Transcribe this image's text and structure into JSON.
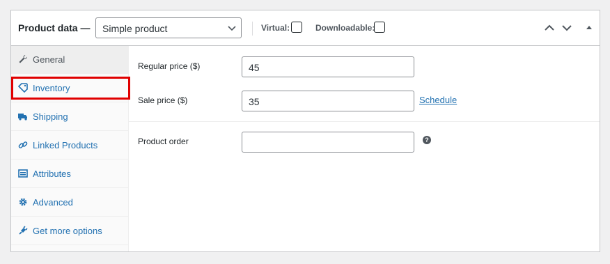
{
  "header": {
    "title": "Product data —",
    "product_type": "Simple product",
    "virtual_label": "Virtual:",
    "downloadable_label": "Downloadable:",
    "virtual_checked": false,
    "downloadable_checked": false
  },
  "sidebar": {
    "items": [
      {
        "label": "General",
        "icon": "wrench-icon",
        "active": true
      },
      {
        "label": "Inventory",
        "icon": "tag-icon",
        "active": false,
        "highlighted": true
      },
      {
        "label": "Shipping",
        "icon": "truck-icon",
        "active": false
      },
      {
        "label": "Linked Products",
        "icon": "link-icon",
        "active": false
      },
      {
        "label": "Attributes",
        "icon": "list-view-icon",
        "active": false
      },
      {
        "label": "Advanced",
        "icon": "gear-icon",
        "active": false
      },
      {
        "label": "Get more options",
        "icon": "plugin-icon",
        "active": false
      }
    ]
  },
  "general": {
    "regular_price_label": "Regular price ($)",
    "regular_price_value": "45",
    "sale_price_label": "Sale price ($)",
    "sale_price_value": "35",
    "schedule_link": "Schedule",
    "product_order_label": "Product order",
    "product_order_value": "",
    "help_symbol": "?"
  },
  "colors": {
    "accent": "#2271b1",
    "highlight": "#e00000",
    "border": "#c3c4c7"
  }
}
